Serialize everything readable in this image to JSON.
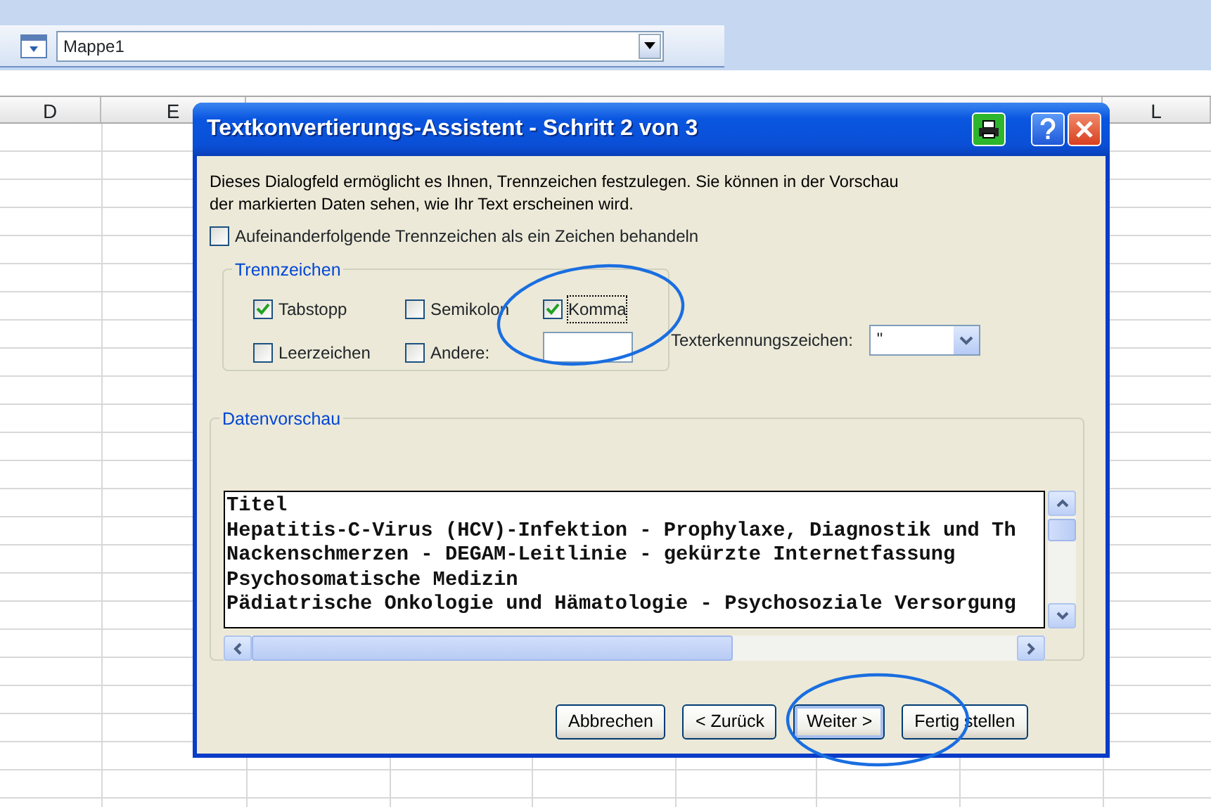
{
  "toolbar": {
    "workbook_field": {
      "value": "Mappe1"
    }
  },
  "sheet": {
    "columns": [
      "D",
      "E",
      "L"
    ]
  },
  "dialog": {
    "title": "Textkonvertierungs-Assistent - Schritt 2 von 3",
    "description": "Dieses Dialogfeld ermöglicht es Ihnen, Trennzeichen festzulegen. Sie können in der Vorschau der markierten Daten sehen, wie Ihr Text erscheinen wird.",
    "consecutive": {
      "label": "Aufeinanderfolgende Trennzeichen als ein Zeichen behandeln",
      "checked": false
    },
    "delimiters": {
      "legend": "Trennzeichen",
      "options": [
        {
          "label": "Tabstopp",
          "checked": true
        },
        {
          "label": "Semikolon",
          "checked": false
        },
        {
          "label": "Komma",
          "checked": true,
          "focused": true
        },
        {
          "label": "Leerzeichen",
          "checked": false
        },
        {
          "label": "Andere:",
          "checked": false
        }
      ]
    },
    "qualifier": {
      "label": "Texterkennungszeichen:",
      "value": "\""
    },
    "preview": {
      "legend": "Datenvorschau",
      "lines": [
        "Titel",
        "Hepatitis-C-Virus (HCV)-Infektion - Prophylaxe, Diagnostik und Th",
        "Nackenschmerzen - DEGAM-Leitlinie - gekürzte Internetfassung",
        "Psychosomatische Medizin",
        "Pädiatrische Onkologie und Hämatologie - Psychosoziale Versorgung"
      ]
    },
    "buttons": [
      {
        "label": "Abbrechen",
        "default": false
      },
      {
        "label": "< Zurück",
        "default": false
      },
      {
        "label": "Weiter >",
        "default": true
      },
      {
        "label": "Fertig stellen",
        "default": false
      }
    ]
  }
}
